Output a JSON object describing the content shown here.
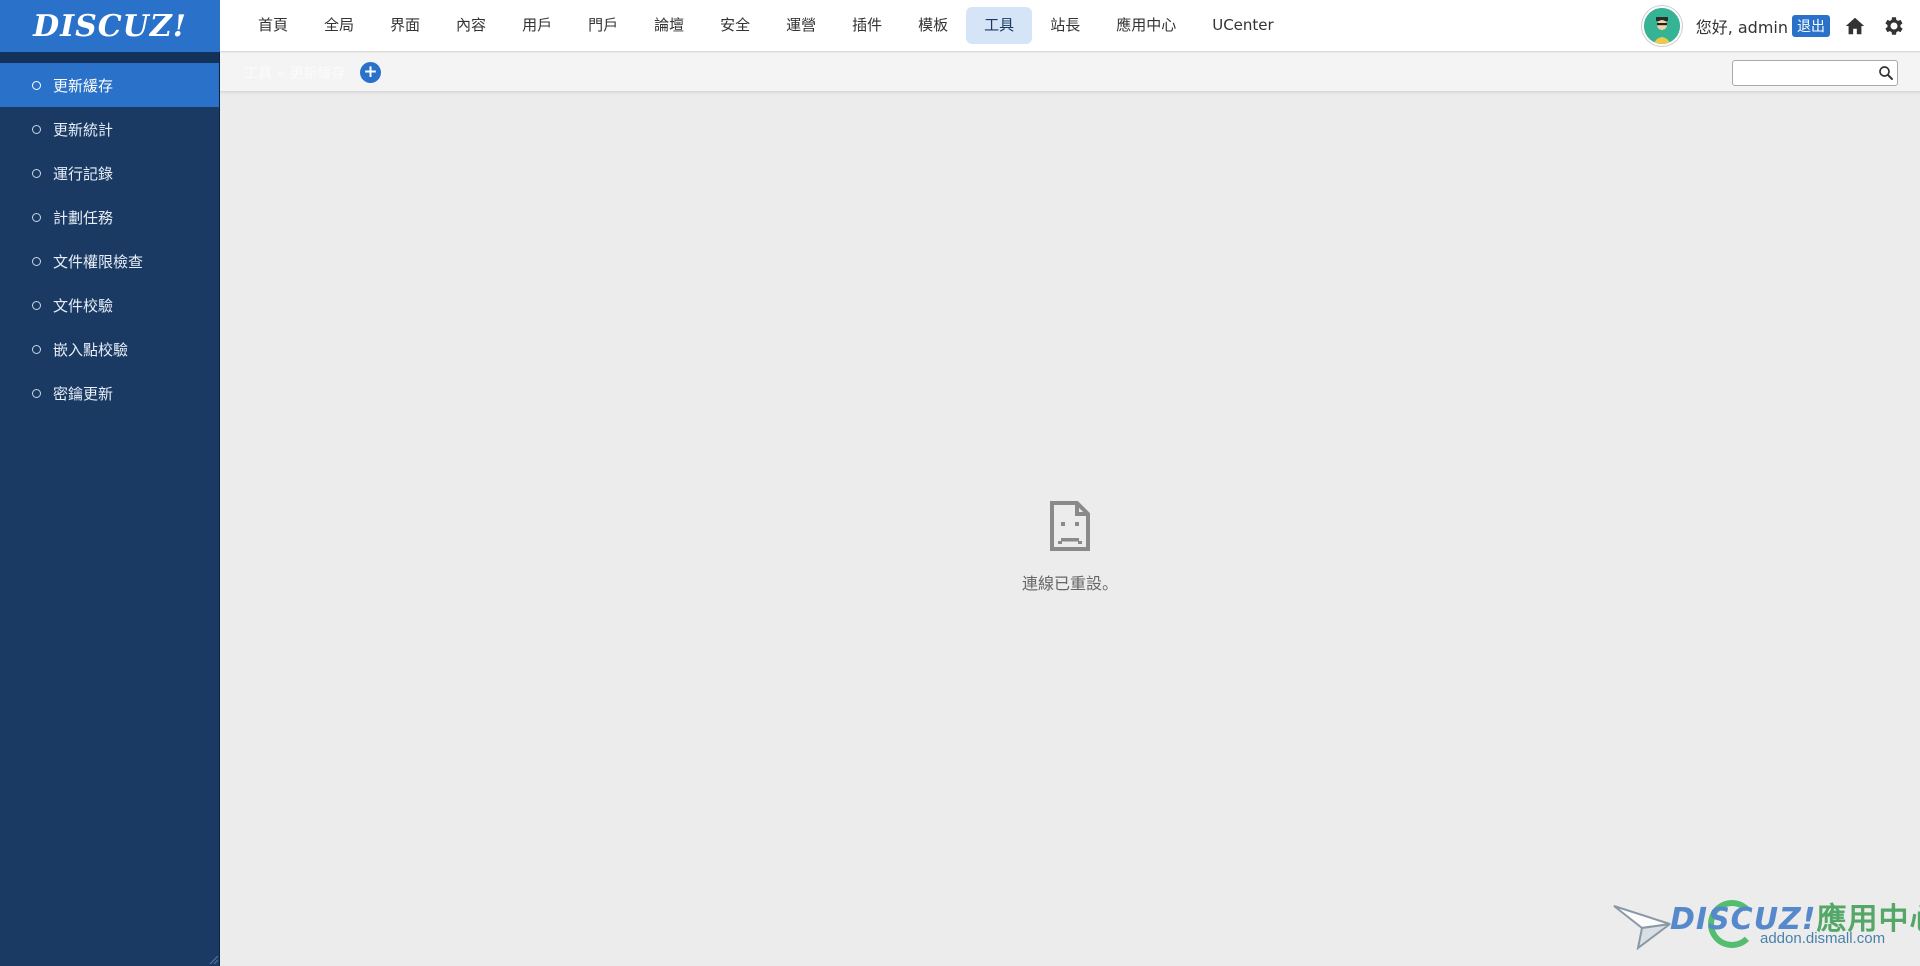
{
  "app": {
    "logo_text": "DISCUZ!"
  },
  "nav": {
    "items": [
      {
        "label": "首頁"
      },
      {
        "label": "全局"
      },
      {
        "label": "界面"
      },
      {
        "label": "內容"
      },
      {
        "label": "用戶"
      },
      {
        "label": "門戶"
      },
      {
        "label": "論壇"
      },
      {
        "label": "安全"
      },
      {
        "label": "運營"
      },
      {
        "label": "插件"
      },
      {
        "label": "模板"
      },
      {
        "label": "工具",
        "active": true
      },
      {
        "label": "站長"
      },
      {
        "label": "應用中心"
      },
      {
        "label": "UCenter"
      }
    ]
  },
  "user": {
    "greeting": "您好, admin",
    "logout_label": "退出"
  },
  "sidebar": {
    "items": [
      {
        "label": "更新緩存",
        "active": true
      },
      {
        "label": "更新統計"
      },
      {
        "label": "運行記錄"
      },
      {
        "label": "計劃任務"
      },
      {
        "label": "文件權限檢查"
      },
      {
        "label": "文件校驗"
      },
      {
        "label": "嵌入點校驗"
      },
      {
        "label": "密鑰更新"
      }
    ]
  },
  "breadcrumb": {
    "text": "工具 » 更新緩存",
    "add_label": "+"
  },
  "search": {
    "value": "",
    "placeholder": ""
  },
  "error": {
    "message": "連線已重設。"
  },
  "watermark": {
    "title_latin": "DISCUZ!",
    "title_cn": "應用中心",
    "url": "addon.dismall.com"
  },
  "colors": {
    "sidebar": "#1a3a63",
    "accent": "#2a72c9",
    "nav_active_bg": "#d5e5f7",
    "content_bg": "#ececec"
  },
  "icons": {
    "home": "home-icon",
    "settings": "gear-icon",
    "search": "search-icon",
    "error": "broken-page-icon"
  }
}
